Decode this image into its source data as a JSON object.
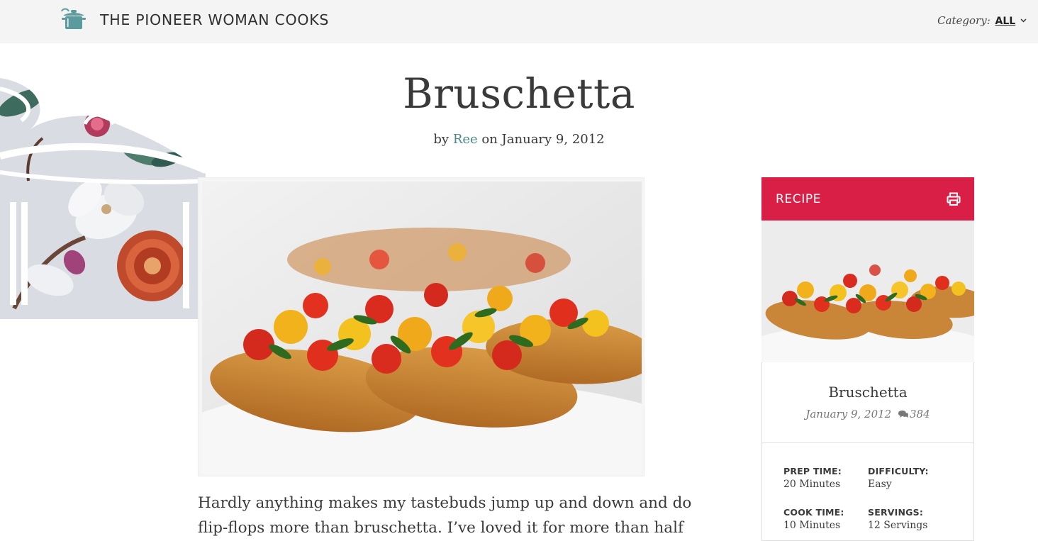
{
  "header": {
    "site_title": "THE PIONEER WOMAN COOKS",
    "category_label": "Category:",
    "category_value": "ALL",
    "logo_icon": "cooking-pot-icon",
    "chevron_icon": "chevron-down-icon"
  },
  "post": {
    "title": "Bruschetta",
    "by_prefix": "by",
    "author": "Ree",
    "date_text": "on January 9, 2012",
    "body": "Hardly anything makes my tastebuds jump up and down and do flip-flops more than bruschetta. I’ve loved it for more than half"
  },
  "recipe_card": {
    "header_label": "RECIPE",
    "print_icon": "printer-icon",
    "name": "Bruschetta",
    "date": "January 9, 2012",
    "comment_icon": "comments-icon",
    "comment_count": "384",
    "stats": {
      "prep_time_label": "PREP TIME:",
      "prep_time_value": "20 Minutes",
      "difficulty_label": "DIFFICULTY:",
      "difficulty_value": "Easy",
      "cook_time_label": "COOK TIME:",
      "cook_time_value": "10 Minutes",
      "servings_label": "SERVINGS:",
      "servings_value": "12 Servings"
    }
  },
  "colors": {
    "accent_red": "#d91f45",
    "author_teal": "#4a8a8c",
    "logo_teal": "#5b9b9d",
    "header_bg": "#f4f4f4"
  }
}
